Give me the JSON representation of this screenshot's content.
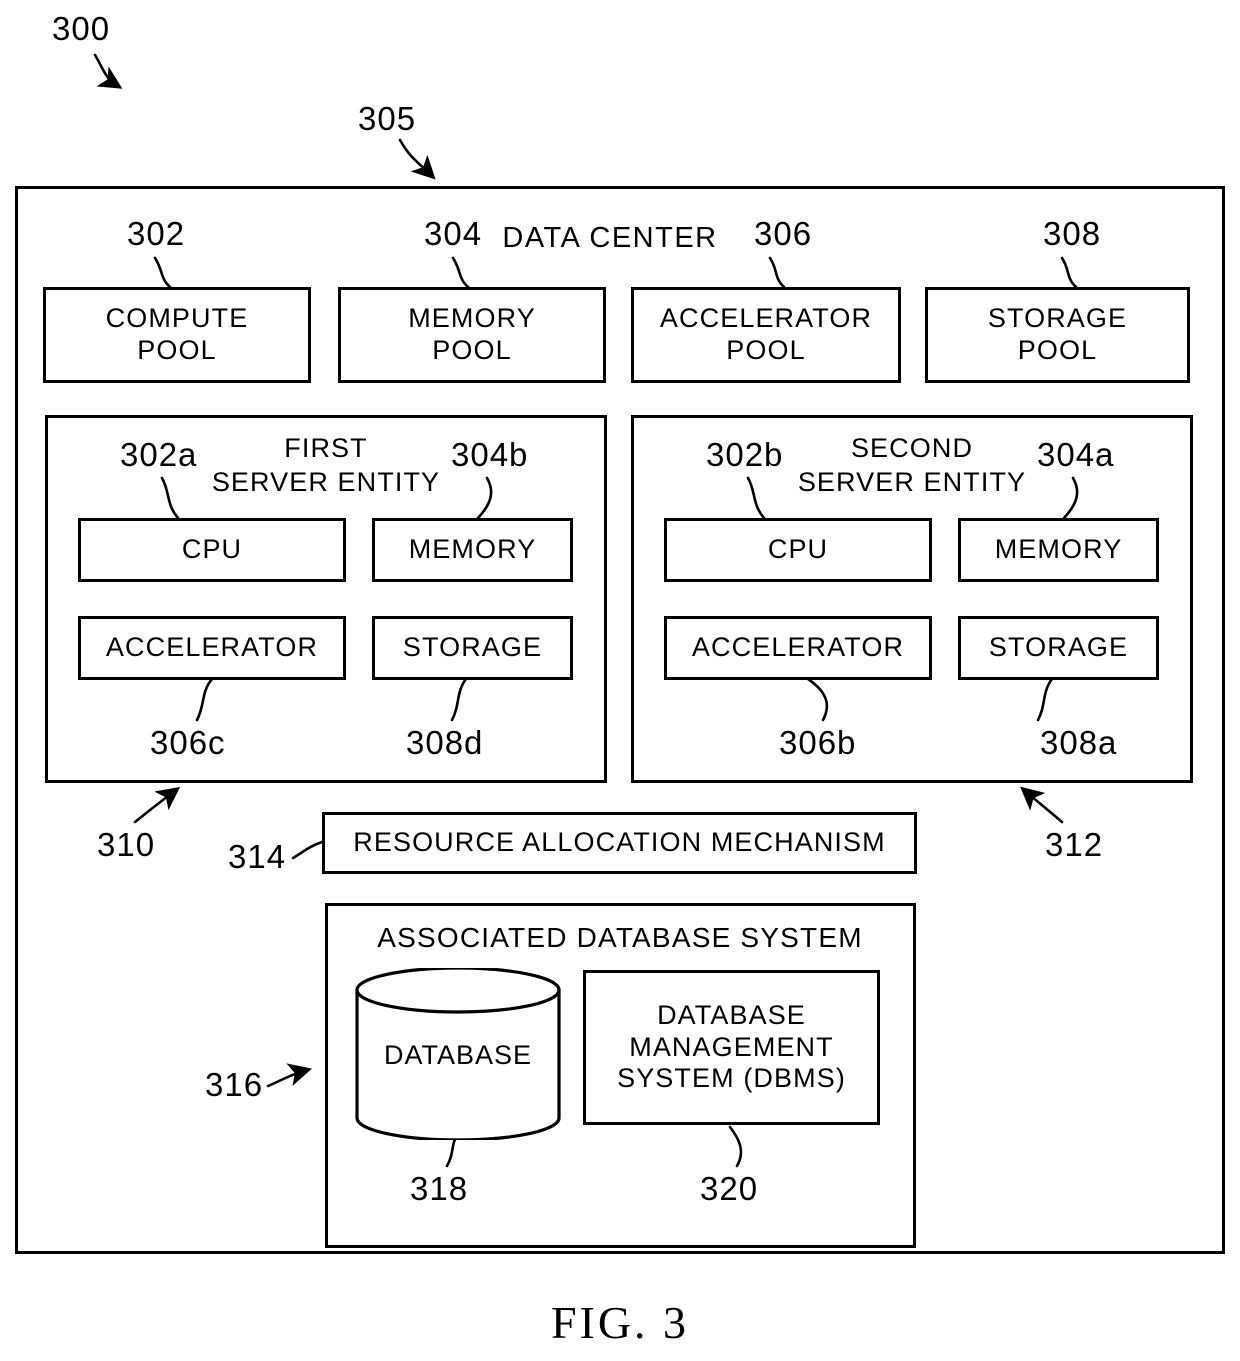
{
  "figure": {
    "caption": "FIG. 3",
    "top_numeral": "300",
    "frame_numeral": "305"
  },
  "data_center": {
    "title": "DATA CENTER",
    "pools": [
      {
        "numeral": "302",
        "label": "COMPUTE\nPOOL"
      },
      {
        "numeral": "304",
        "label": "MEMORY\nPOOL"
      },
      {
        "numeral": "306",
        "label": "ACCELERATOR\nPOOL"
      },
      {
        "numeral": "308",
        "label": "STORAGE\nPOOL"
      }
    ],
    "server_entities": [
      {
        "numeral": "310",
        "title": "FIRST\nSERVER ENTITY",
        "components": [
          {
            "label": "CPU",
            "numeral": "302a",
            "numeral_pos": "top"
          },
          {
            "label": "MEMORY",
            "numeral": "304b",
            "numeral_pos": "top"
          },
          {
            "label": "ACCELERATOR",
            "numeral": "306c",
            "numeral_pos": "bottom"
          },
          {
            "label": "STORAGE",
            "numeral": "308d",
            "numeral_pos": "bottom"
          }
        ]
      },
      {
        "numeral": "312",
        "title": "SECOND\nSERVER ENTITY",
        "components": [
          {
            "label": "CPU",
            "numeral": "302b",
            "numeral_pos": "top"
          },
          {
            "label": "MEMORY",
            "numeral": "304a",
            "numeral_pos": "top"
          },
          {
            "label": "ACCELERATOR",
            "numeral": "306b",
            "numeral_pos": "bottom"
          },
          {
            "label": "STORAGE",
            "numeral": "308a",
            "numeral_pos": "bottom"
          }
        ]
      }
    ],
    "resource_allocation": {
      "numeral": "314",
      "label": "RESOURCE ALLOCATION MECHANISM"
    },
    "database_system": {
      "numeral": "316",
      "title": "ASSOCIATED DATABASE SYSTEM",
      "database": {
        "numeral": "318",
        "label": "DATABASE"
      },
      "dbms": {
        "numeral": "320",
        "label": "DATABASE\nMANAGEMENT\nSYSTEM (DBMS)"
      }
    }
  },
  "style": {
    "line_color": "#000000",
    "background": "#ffffff"
  }
}
